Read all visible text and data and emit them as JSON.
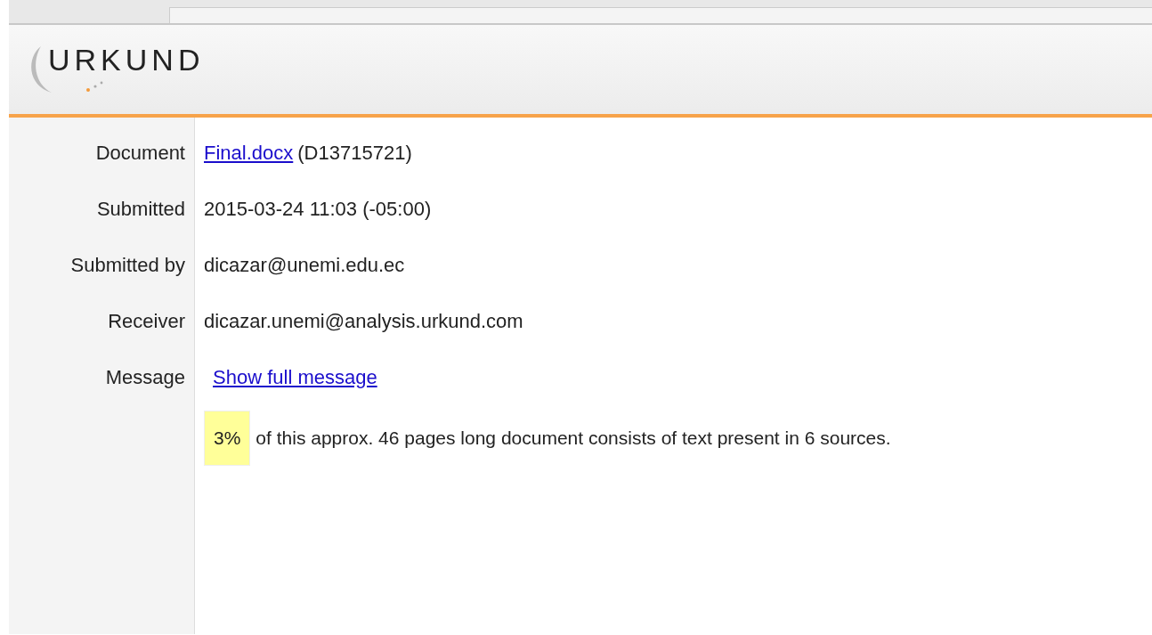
{
  "logo": {
    "text": "URKUND"
  },
  "rows": [
    {
      "label": "Document",
      "kind": "link_text",
      "link": "Final.docx",
      "text": "(D13715721)"
    },
    {
      "label": "Submitted",
      "kind": "text",
      "text": "2015-03-24 11:03 (-05:00)"
    },
    {
      "label": "Submitted by",
      "kind": "text",
      "text": "dicazar@unemi.edu.ec"
    },
    {
      "label": "Receiver",
      "kind": "text",
      "text": "dicazar.unemi@analysis.urkund.com"
    },
    {
      "label": "Message",
      "kind": "link",
      "link": "Show full message"
    }
  ],
  "summary": {
    "percent": "3%",
    "text": "of this approx. 46 pages long document consists of text present in 6 sources."
  }
}
